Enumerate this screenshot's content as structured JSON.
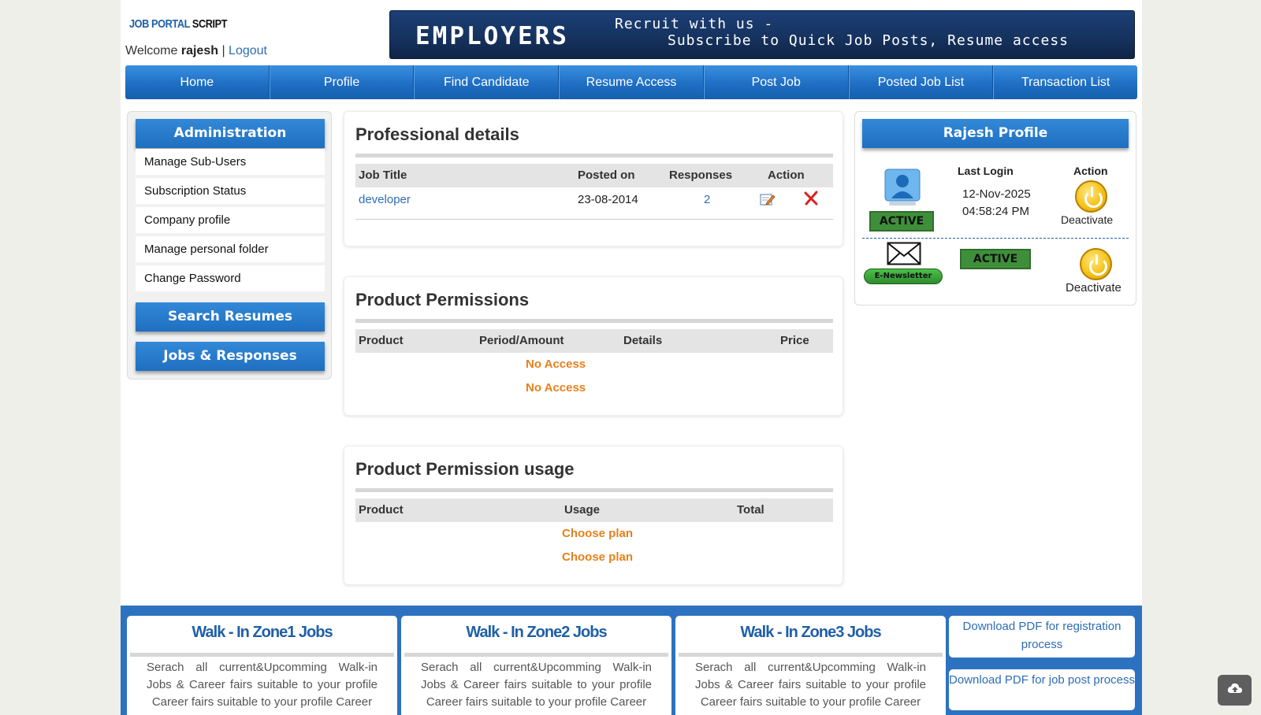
{
  "header": {
    "logo_part1": "JOB PORTAL",
    "logo_part2": "SCRIPT",
    "welcome_prefix": "Welcome",
    "username": "rajesh",
    "separator": "|",
    "logout": "Logout",
    "banner": {
      "title": "EMPLOYERS",
      "line1": "Recruit with us -",
      "line2": "Subscribe to Quick Job Posts, Resume access"
    }
  },
  "nav": [
    "Home",
    "Profile",
    "Find Candidate",
    "Resume Access",
    "Post Job",
    "Posted Job List",
    "Transaction List"
  ],
  "sidebar": {
    "admin_title": "Administration",
    "items": [
      "Manage Sub-Users",
      "Subscription Status",
      "Company profile",
      "Manage personal folder",
      "Change Password"
    ],
    "search_resumes": "Search Resumes",
    "jobs_responses": "Jobs & Responses"
  },
  "professional": {
    "title": "Professional details",
    "columns": [
      "Job Title",
      "Posted on",
      "Responses",
      "Action"
    ],
    "rows": [
      {
        "job_title": "developer",
        "posted_on": "23-08-2014",
        "responses": "2"
      }
    ]
  },
  "permissions": {
    "title": "Product Permissions",
    "columns": [
      "Product",
      "Period/Amount",
      "Details",
      "Price"
    ],
    "rows": [
      "No Access",
      "No Access"
    ]
  },
  "usage": {
    "title": "Product Permission usage",
    "columns": [
      "Product",
      "Usage",
      "Total"
    ],
    "rows": [
      "Choose plan",
      "Choose plan"
    ]
  },
  "profile": {
    "title": "Rajesh Profile",
    "last_login_label": "Last Login",
    "action_label": "Action",
    "last_login_date": "12-Nov-2025",
    "last_login_time": "04:58:24 PM",
    "status_active": "ACTIVE",
    "deactivate": "Deactivate",
    "newsletter_label": "E-Newsletter",
    "newsletter_status": "ACTIVE",
    "newsletter_deactivate": "Deactivate"
  },
  "footer": {
    "zones": [
      {
        "title": "Walk - In Zone1 Jobs",
        "text": "Serach all current&Upcomming Walk-in Jobs & Career fairs suitable to your profile Career fairs suitable to your profile Career"
      },
      {
        "title": "Walk - In Zone2 Jobs",
        "text": "Serach all current&Upcomming Walk-in Jobs & Career fairs suitable to your profile Career fairs suitable to your profile Career"
      },
      {
        "title": "Walk - In Zone3 Jobs",
        "text": "Serach all current&Upcomming Walk-in Jobs & Career fairs suitable to your profile Career fairs suitable to your profile Career"
      }
    ],
    "download_registration": "Download PDF for registration process",
    "download_jobpost": "Download PDF for job post process"
  },
  "colors": {
    "nav_blue": "#1f6fc4",
    "active_green": "#3f8f3a",
    "orange_text": "#e8801a",
    "link_blue": "#2d6db5"
  }
}
